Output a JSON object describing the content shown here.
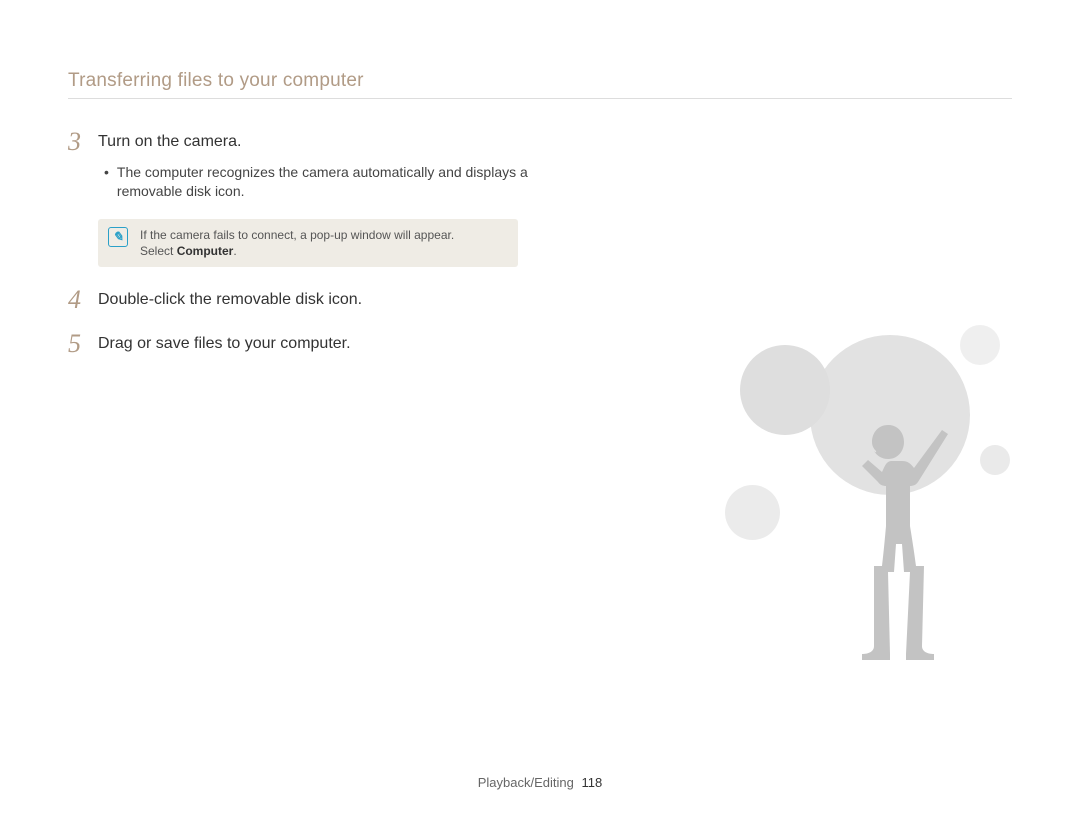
{
  "header": {
    "title": "Transferring files to your computer"
  },
  "steps": [
    {
      "num": "3",
      "text": "Turn on the camera.",
      "sub": "The computer recognizes the camera automatically and displays a removable disk icon.",
      "note_line1": "If the camera fails to connect, a pop-up window will appear.",
      "note_line2_prefix": "Select ",
      "note_line2_bold": "Computer",
      "note_line2_suffix": "."
    },
    {
      "num": "4",
      "text": "Double-click the removable disk icon."
    },
    {
      "num": "5",
      "text": "Drag or save files to your computer."
    }
  ],
  "footer": {
    "section": "Playback/Editing",
    "page": "118"
  }
}
